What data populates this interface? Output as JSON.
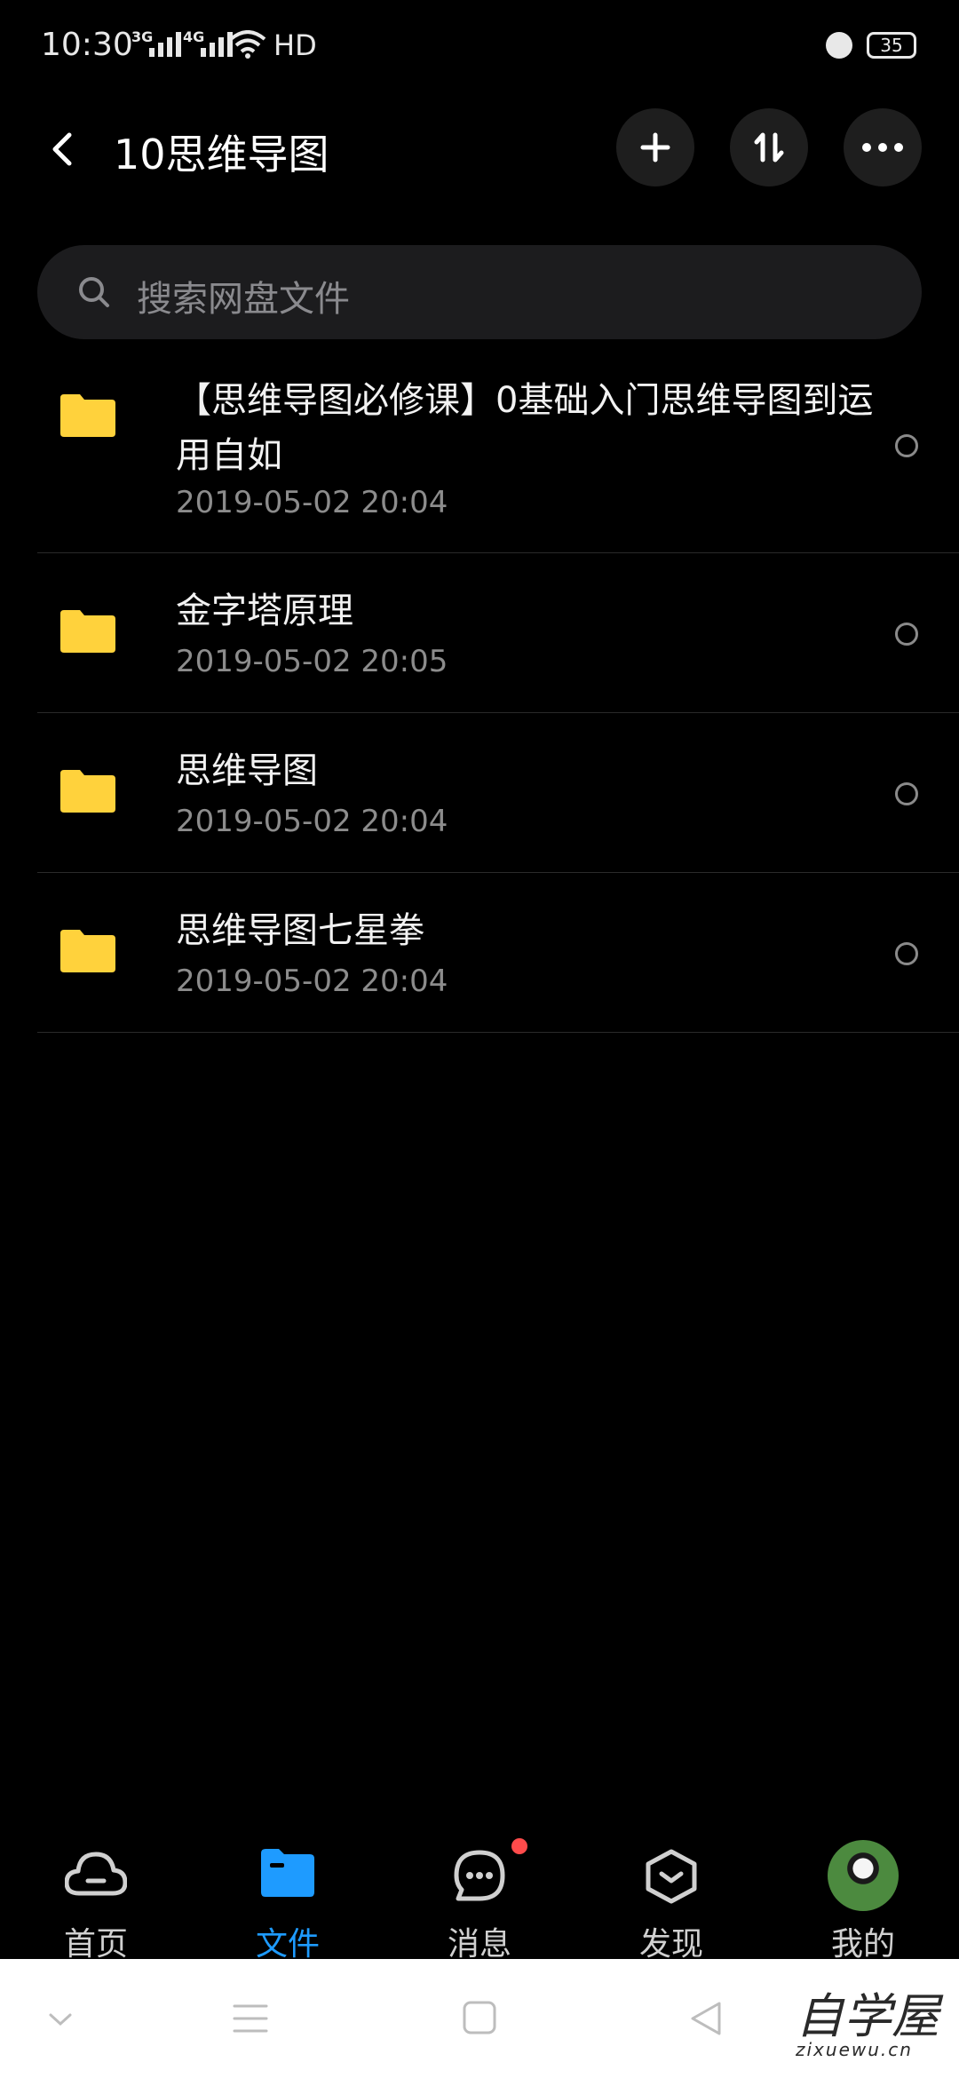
{
  "status_bar": {
    "time": "10:30",
    "network1": "3G",
    "network2": "4G",
    "hd": "HD",
    "battery": "35"
  },
  "header": {
    "title": "10思维导图",
    "icons": [
      "back-icon",
      "plus-icon",
      "sort-icon",
      "more-icon"
    ]
  },
  "search": {
    "placeholder": "搜索网盘文件"
  },
  "files": [
    {
      "name": "【思维导图必修课】0基础入门思维导图到运用自如",
      "date": "2019-05-02  20:04"
    },
    {
      "name": "金字塔原理",
      "date": "2019-05-02  20:05"
    },
    {
      "name": "思维导图",
      "date": "2019-05-02  20:04"
    },
    {
      "name": "思维导图七星拳",
      "date": "2019-05-02  20:04"
    }
  ],
  "tabbar": {
    "items": [
      {
        "label": "首页",
        "icon": "cloud-icon"
      },
      {
        "label": "文件",
        "icon": "folder-icon",
        "active": true
      },
      {
        "label": "消息",
        "icon": "chat-icon",
        "badge": true
      },
      {
        "label": "发现",
        "icon": "discover-icon"
      },
      {
        "label": "我的",
        "icon": "avatar"
      }
    ]
  },
  "watermark": {
    "text": "自学屋",
    "url": "zixuewu.cn"
  },
  "colors": {
    "accent": "#1e9bff",
    "folder": "#ffd23c",
    "badge": "#ff4b4b"
  }
}
